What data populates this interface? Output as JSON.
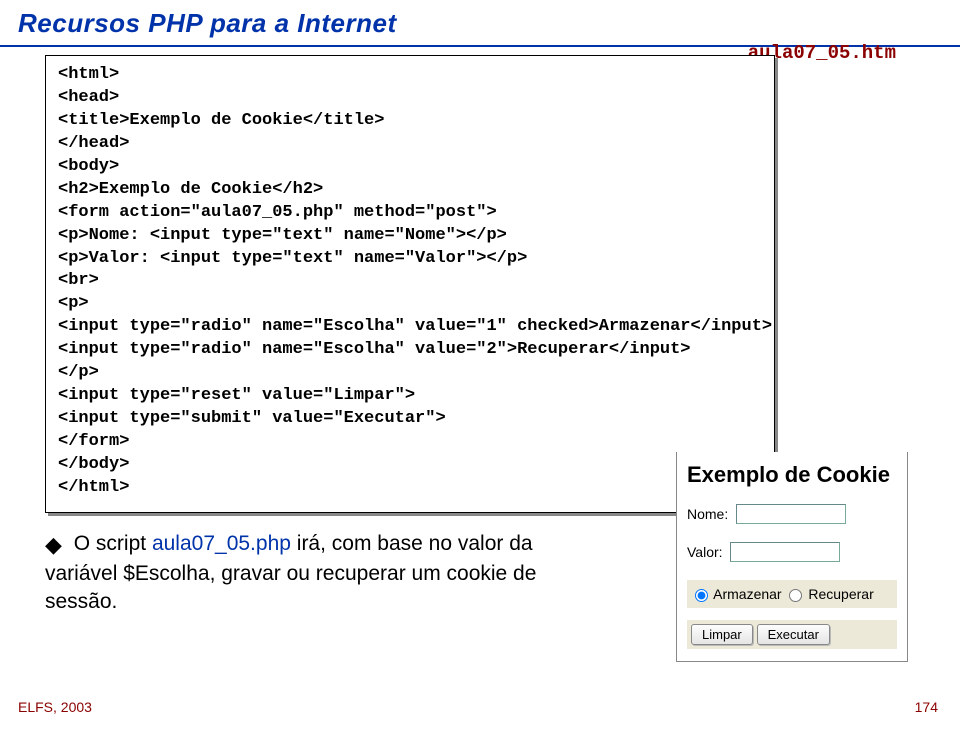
{
  "title": "Recursos PHP para a Internet",
  "filename": "aula07_05.htm",
  "code": "<html>\n<head>\n<title>Exemplo de Cookie</title>\n</head>\n<body>\n<h2>Exemplo de Cookie</h2>\n<form action=\"aula07_05.php\" method=\"post\">\n<p>Nome: <input type=\"text\" name=\"Nome\"></p>\n<p>Valor: <input type=\"text\" name=\"Valor\"></p>\n<br>\n<p>\n<input type=\"radio\" name=\"Escolha\" value=\"1\" checked>Armazenar</input>\n<input type=\"radio\" name=\"Escolha\" value=\"2\">Recuperar</input>\n</p>\n<input type=\"reset\" value=\"Limpar\">\n<input type=\"submit\" value=\"Executar\">\n</form>\n</body>\n</html>",
  "bullet": {
    "prefix": "O script ",
    "link": "aula07_05.php",
    "suffix": " irá, com base no valor da variável $Escolha, gravar ou recuperar um cookie de sessão."
  },
  "browser": {
    "heading": "Exemplo de Cookie",
    "nome_label": "Nome:",
    "valor_label": "Valor:",
    "opt1": "Armazenar",
    "opt2": "Recuperar",
    "btn_reset": "Limpar",
    "btn_submit": "Executar"
  },
  "footer": {
    "left": "ELFS, 2003",
    "right": "174"
  }
}
